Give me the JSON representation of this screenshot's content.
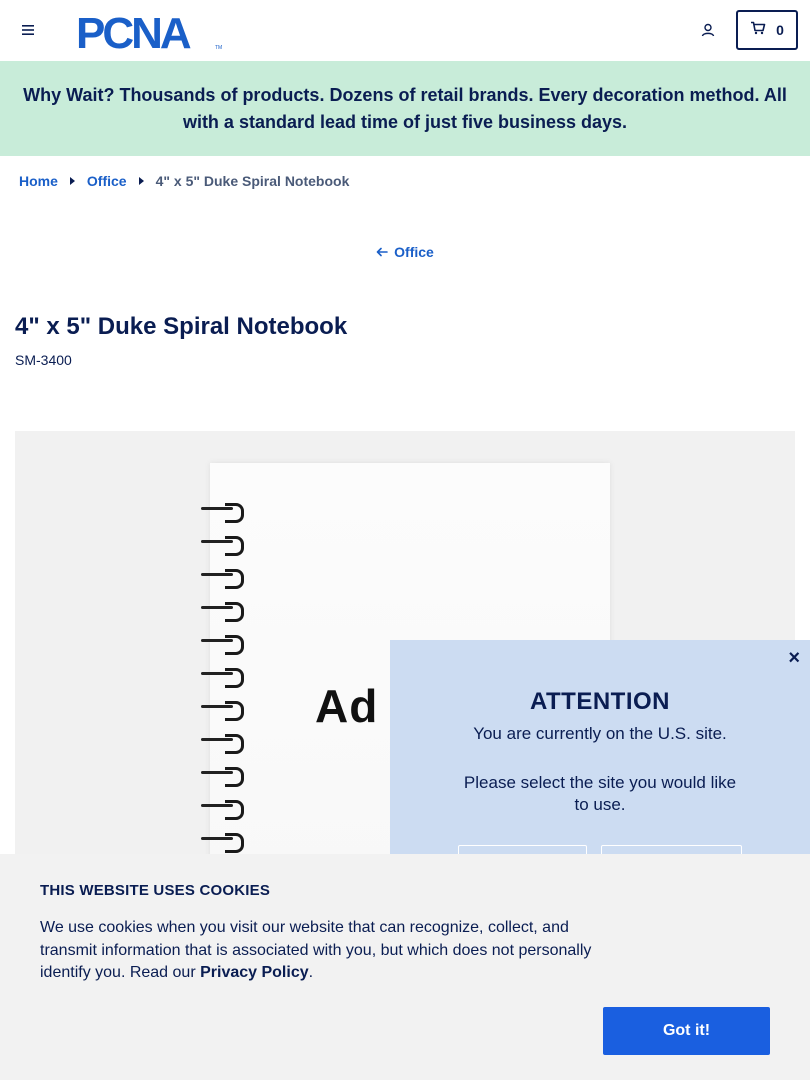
{
  "header": {
    "logo_text": "PCNA",
    "cart_count": "0"
  },
  "banner": {
    "text": "Why Wait? Thousands of products. Dozens of retail brands. Every decoration method. All with a standard lead time of just five business days."
  },
  "breadcrumb": {
    "items": [
      "Home",
      "Office"
    ],
    "current": "4\" x 5\" Duke Spiral Notebook"
  },
  "back_link": {
    "label": "Office"
  },
  "product": {
    "title": "4\" x 5\" Duke Spiral Notebook",
    "sku": "SM-3400",
    "imprint_text": "Ad"
  },
  "attention_popup": {
    "close_label": "×",
    "title": "ATTENTION",
    "line1": "You are currently on the U.S. site.",
    "line2": "Please select the site you would like to use."
  },
  "cookie_banner": {
    "title": "THIS WEBSITE USES COOKIES",
    "text_before": "We use cookies when you visit our website that can recognize, collect, and transmit information that is associated with you, but which does not personally identify you. Read our ",
    "policy_link": "Privacy Policy",
    "text_after": ".",
    "accept_label": "Got it!"
  },
  "colors": {
    "brand_navy": "#0a1d52",
    "link_blue": "#1a5fc8",
    "banner_green": "#c8ecd9",
    "popup_blue": "#ccdcf2",
    "button_blue": "#1a5fe0"
  },
  "icons": [
    "hamburger-menu-icon",
    "user-account-icon",
    "cart-icon",
    "arrow-left-icon",
    "close-icon",
    "chevron-right-icon"
  ]
}
